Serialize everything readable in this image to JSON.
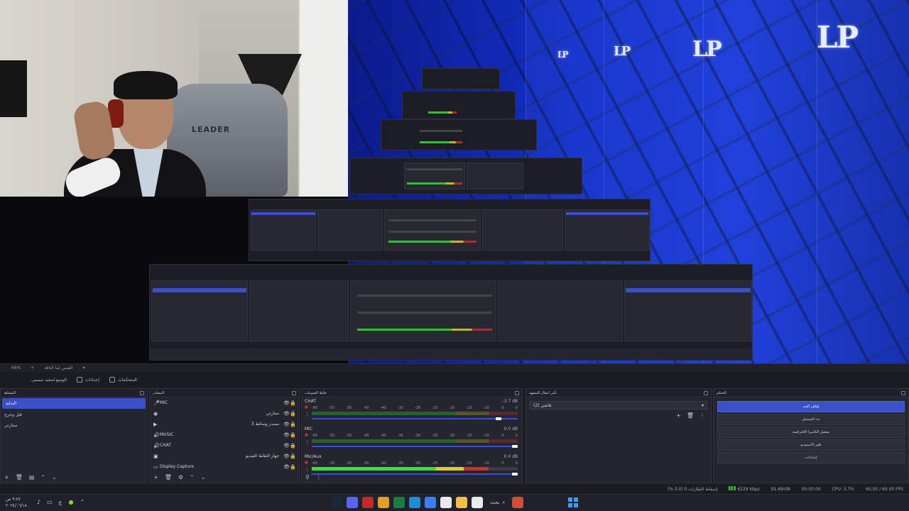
{
  "preview": {
    "camera_brand_text": "LEADER",
    "logo_text": "LP"
  },
  "scene_bar": {
    "zoom": "66%",
    "scene_name": "القيس لما التاقة"
  },
  "mode_bar": {
    "studio_mode": "الوضع لمحيد مسمى",
    "settings": "إعدادات",
    "controls": "المتحكمات"
  },
  "docks": {
    "scenes": {
      "title": "المشاهد",
      "items": [
        {
          "label": "البداية",
          "active": true
        },
        {
          "label": "قبل وجرج",
          "active": false
        },
        {
          "label": "ستارتي",
          "active": false
        }
      ]
    },
    "sources": {
      "title": "المصادر",
      "items": [
        {
          "icon": "mic-icon",
          "glyph": "🎤",
          "label": "MIC",
          "rtl": false
        },
        {
          "icon": "browser-icon",
          "glyph": "◉",
          "label": "ستارتي",
          "rtl": true
        },
        {
          "icon": "media-icon",
          "glyph": "▶",
          "label": "مصدر وسائط 3",
          "rtl": true
        },
        {
          "icon": "speaker-icon",
          "glyph": "🔊",
          "label": "MUSIC",
          "rtl": false
        },
        {
          "icon": "speaker-icon",
          "glyph": "🔊",
          "label": "CHAT",
          "rtl": false
        },
        {
          "icon": "capture-icon",
          "glyph": "▣",
          "label": "جهاز التقاط الفيديو",
          "rtl": true
        },
        {
          "icon": "display-icon",
          "glyph": "▭",
          "label": "Display Capture",
          "rtl": false
        }
      ]
    },
    "mixer": {
      "title": "خلاط الصوتيات",
      "scale": [
        "-60",
        "-55",
        "-50",
        "-45",
        "-40",
        "-35",
        "-30",
        "-25",
        "-20",
        "-15",
        "-10",
        "-5",
        "0"
      ],
      "channels": [
        {
          "name": "CHAT",
          "db": "-3.7 dB",
          "level": 0.0,
          "fader": 0.92
        },
        {
          "name": "MIC",
          "db": "0.0 dB",
          "level": 0.0,
          "fader": 1.0
        },
        {
          "name": "Mic/Aux",
          "db": "0.0 dB",
          "level": 0.86,
          "fader": 1.0
        }
      ]
    },
    "transitions": {
      "title": "تأثير انتقال المشهد",
      "selected": "تلاشي (2)"
    },
    "controls": {
      "title": "التحكم",
      "buttons": [
        {
          "label": "إيقاف البث",
          "primary": true
        },
        {
          "label": "بدء التسجيل",
          "primary": false
        },
        {
          "label": "تشغيل الكاميرا الافتراضية",
          "primary": false
        },
        {
          "label": "طور الاستوديو",
          "primary": false
        },
        {
          "label": "إعدادات",
          "primary": false
        }
      ]
    }
  },
  "status_bar": {
    "frames": "إسقاط الإطارات 0 (0.0 %)",
    "bitrate": "6229 kbps",
    "live": "01:49:09",
    "rec": "00:00:00",
    "cpu": "CPU: 3.7%",
    "fps": "60.00 / 60.00 FPS"
  },
  "taskbar": {
    "time": "٩:٤٧ ص",
    "date": "٢٠٢٤/٠٦/١٨",
    "search_label": "بحث",
    "apps": [
      {
        "name": "steam-icon",
        "color": "#1b2838"
      },
      {
        "name": "discord-icon",
        "color": "#5865f2"
      },
      {
        "name": "chrome-red-icon",
        "color": "#c62828"
      },
      {
        "name": "chrome-icon",
        "color": "#e0a020"
      },
      {
        "name": "excel-icon",
        "color": "#1d7a43"
      },
      {
        "name": "edge-icon",
        "color": "#1a8fd6"
      },
      {
        "name": "browser-icon",
        "color": "#3b7ef0"
      },
      {
        "name": "calendar-icon",
        "color": "#e8e8ee"
      },
      {
        "name": "folder-icon",
        "color": "#f0c040"
      },
      {
        "name": "notepad-icon",
        "color": "#eaeaea"
      },
      {
        "name": "files-icon",
        "color": "#d94a3a"
      }
    ]
  }
}
